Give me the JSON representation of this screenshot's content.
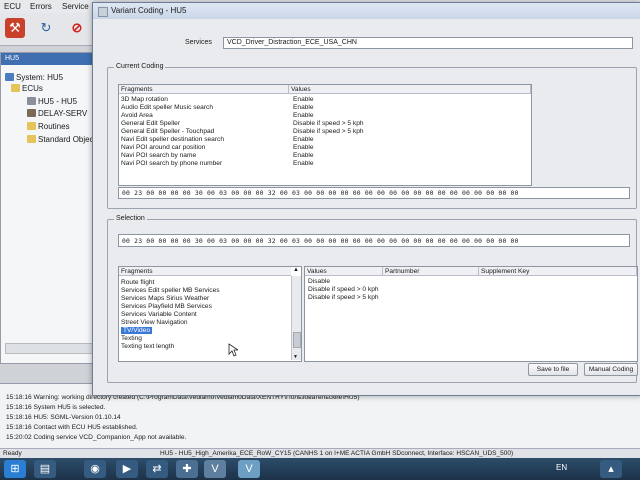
{
  "menubar": {
    "items": [
      "ECU",
      "Errors",
      "Service"
    ]
  },
  "toolbar": {
    "icons": [
      "tools-icon",
      "refresh-icon",
      "stop-icon"
    ]
  },
  "tree": {
    "header": "HU5",
    "items": [
      {
        "label": "System: HU5",
        "icon": "system-icon"
      },
      {
        "label": "ECUs",
        "icon": "folder-icon"
      },
      {
        "label": "HU5 - HU5",
        "icon": "ecu-icon"
      },
      {
        "label": "DELAY-SERV",
        "icon": "service-icon"
      },
      {
        "label": "Routines",
        "icon": "folder-icon"
      },
      {
        "label": "Standard Objects",
        "icon": "folder-icon"
      }
    ],
    "scroll_arrow": "»"
  },
  "log": {
    "lines": [
      "15:18:16 Warning: working directory created (C:\\ProgramData\\Vediamo\\VediamoData\\XENTRY\\Пользовательские\\HU5)",
      "15:18:16 System HU5 is selected.",
      "15:18:16 HU5: SGML-Version 01.10.14",
      "15:18:16 Contact with ECU HU5 established.",
      "15:20:02 Coding service VCD_Companion_App not available."
    ]
  },
  "statusbar": {
    "left": "Ready",
    "right": "HU5 - HU5_High_Amerika_ECE_RoW_CY15 (CANHS 1 on I+ME ACTIA GmbH SDconnect, Interface: HSCAN_UDS_500)"
  },
  "taskbar": {
    "lang": "EN"
  },
  "dialog": {
    "title": "Variant Coding - HU5",
    "services_label": "Services",
    "services_value": "VCD_Driver_Distraction_ECE_USA_CHN",
    "current_coding": {
      "label": "Current Coding",
      "col_fragments": "Fragments",
      "col_values": "Values",
      "rows": [
        {
          "fragment": "3D Map rotation",
          "value": "Enable"
        },
        {
          "fragment": "Audio Edit speller Music search",
          "value": "Enable"
        },
        {
          "fragment": "Avoid Area",
          "value": "Enable"
        },
        {
          "fragment": "General Edit Speller",
          "value": "Disable if speed > 5 kph"
        },
        {
          "fragment": "General Edit Speller - Touchpad",
          "value": "Disable if speed > 5 kph"
        },
        {
          "fragment": "Navi Edit speller destination search",
          "value": "Enable"
        },
        {
          "fragment": "Navi POI around car position",
          "value": "Enable"
        },
        {
          "fragment": "Navi POI search by name",
          "value": "Enable"
        },
        {
          "fragment": "Navi POI search by phone number",
          "value": "Enable"
        }
      ],
      "hex": "00 23 00 00 00 00 30 00 03 00 00 00 32 00 03 00 00 00 00 00 00 00 00 00 00 00 00 00 00 00 00 00 00"
    },
    "selection": {
      "label": "Selection",
      "hex": "00 23 00 00 00 00 30 00 03 00 00 00 32 00 03 00 00 00 00 00 00 00 00 00 00 00 00 00 00 00 00 00 00",
      "fragments_header": "Fragments",
      "fragments": [
        "Route flight",
        "Services Edit speller MB Services",
        "Services Maps Sirius Weather",
        "Services Playfield MB Services",
        "Services Variable Content",
        "Street View Navigation",
        "TV/Video",
        "Texting",
        "Texting text length"
      ],
      "selected_index": 6,
      "values_headers": [
        "Values",
        "Partnumber",
        "Supplement Key"
      ],
      "values": [
        "Disable",
        "Disable if speed > 0 kph",
        "Disable if speed > 5 kph"
      ]
    },
    "buttons": {
      "save": "Save to file",
      "manual": "Manual Coding"
    }
  }
}
